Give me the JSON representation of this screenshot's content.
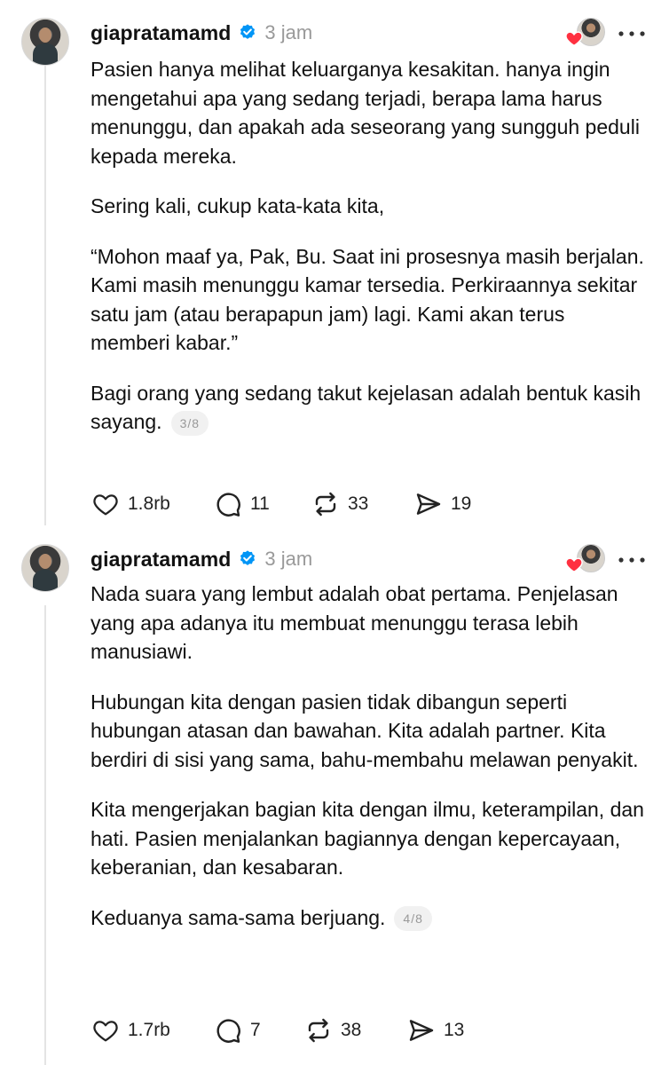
{
  "posts": [
    {
      "username": "giapratamamd",
      "time": "3 jam",
      "paragraphs": [
        "Pasien hanya melihat keluarganya kesakitan. hanya ingin mengetahui apa yang sedang terjadi, berapa lama harus menunggu, dan apakah ada seseorang yang sungguh peduli kepada mereka.",
        "Sering kali, cukup kata-kata kita,",
        "“Mohon maaf ya, Pak, Bu. Saat ini prosesnya masih berjalan. Kami masih menunggu kamar tersedia. Perkiraannya sekitar satu jam (atau berapapun jam) lagi. Kami akan terus memberi kabar.”",
        "Bagi orang yang sedang takut kejelasan adalah bentuk kasih sayang."
      ],
      "page_badge": "3/8",
      "likes": "1.8rb",
      "replies": "11",
      "reposts": "33",
      "shares": "19"
    },
    {
      "username": "giapratamamd",
      "time": "3 jam",
      "paragraphs": [
        "Nada suara yang lembut adalah obat pertama. Penjelasan yang apa adanya itu membuat menunggu terasa lebih manusiawi.",
        "Hubungan kita dengan pasien tidak dibangun seperti hubungan atasan dan bawahan. Kita adalah partner. Kita berdiri di sisi yang sama, bahu-membahu melawan penyakit.",
        "Kita mengerjakan bagian kita dengan ilmu, keterampilan, dan hati. Pasien menjalankan bagiannya dengan kepercayaan, keberanian, dan kesabaran.",
        "Keduanya sama-sama berjuang."
      ],
      "page_badge": "4/8",
      "likes": "1.7rb",
      "replies": "7",
      "reposts": "38",
      "shares": "13"
    }
  ],
  "icons": {
    "verified": "verified-badge-icon",
    "heart": "heart-icon",
    "reply": "speech-bubble-icon",
    "repost": "repost-arrows-icon",
    "share": "paper-plane-icon",
    "more": "three-dots-icon"
  },
  "colors": {
    "verified_blue": "#0095f6",
    "like_red": "#ff3040",
    "muted_text": "#999999"
  }
}
